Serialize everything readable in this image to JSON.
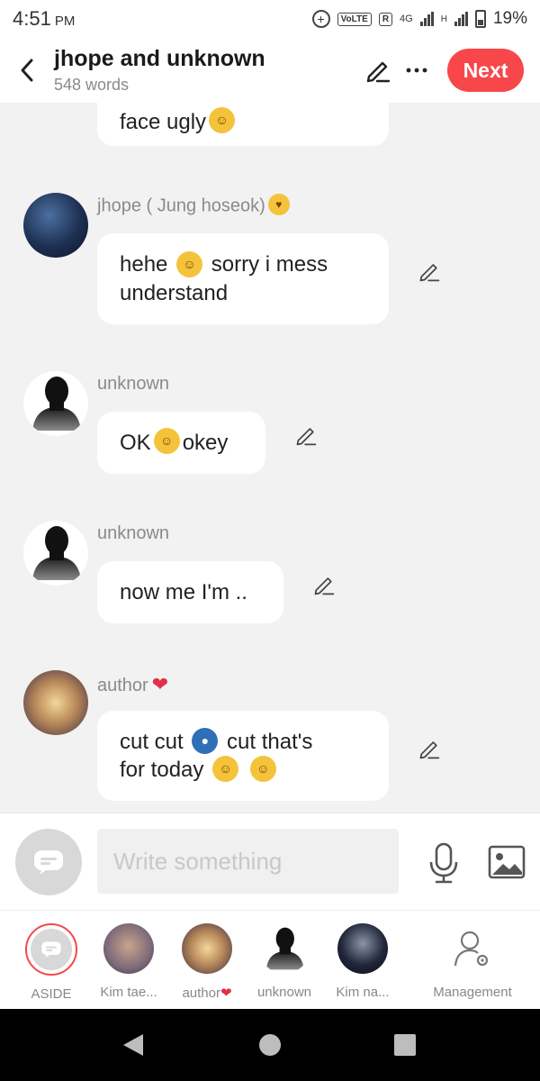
{
  "status_bar": {
    "time": "4:51",
    "ampm": "PM",
    "volte": "VoLTE",
    "r_badge": "R",
    "network": "4G",
    "network2": "H",
    "battery": "19%"
  },
  "header": {
    "back_icon": "chevron-left-icon",
    "title": "jhope and unknown",
    "subtitle": "548 words",
    "next_label": "Next"
  },
  "messages": [
    {
      "sender": "",
      "text": "face ugly",
      "emoji_after": "grimacing"
    },
    {
      "sender": "jhope ( Jung hoseok)",
      "text1": "hehe",
      "text2": "sorry i mess",
      "text3": "understand"
    },
    {
      "sender": "unknown",
      "text1": "OK",
      "text2": "okey"
    },
    {
      "sender": "unknown",
      "text": "now me I'm .."
    },
    {
      "sender": "author",
      "text1": "cut cut",
      "text2": "cut that's",
      "text3": "for today"
    }
  ],
  "input": {
    "placeholder": "Write something"
  },
  "characters": [
    {
      "label": "ASIDE"
    },
    {
      "label": "Kim tae..."
    },
    {
      "label": "author"
    },
    {
      "label": "unknown"
    },
    {
      "label": "Kim na..."
    },
    {
      "label": "Management"
    }
  ],
  "colors": {
    "accent": "#f7474b",
    "background": "#f2f2f2",
    "bubble": "#ffffff"
  }
}
